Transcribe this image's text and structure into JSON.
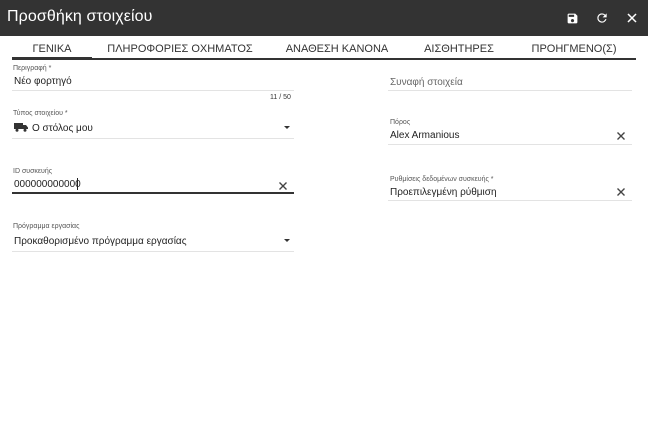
{
  "window": {
    "title": "Προσθήκη στοιχείου"
  },
  "tabs": [
    {
      "label": "ΓΕΝΙΚΑ",
      "active": true
    },
    {
      "label": "ΠΛΗΡΟΦΟΡΙΕΣ ΟΧΗΜΑΤΟΣ",
      "active": false
    },
    {
      "label": "ΑΝΑΘΕΣΗ ΚΑΝΟΝΑ",
      "active": false
    },
    {
      "label": "ΑΙΣΘΗΤΗΡΕΣ",
      "active": false
    },
    {
      "label": "ΠΡΟΗΓΜΕΝΟ(Σ)",
      "active": false
    }
  ],
  "form": {
    "description": {
      "label": "Περιγραφή *",
      "value": "Νέο φορτηγό",
      "counter": "11 / 50"
    },
    "asset_type": {
      "label": "Τύπος στοιχείου *",
      "value": "Ο στόλος μου",
      "icon": "truck-icon"
    },
    "device_id": {
      "label": "ID συσκευής",
      "value": "000000000000"
    },
    "work_schedule": {
      "label": "Πρόγραμμα εργασίας",
      "value": "Προκαθορισμένο πρόγραμμα εργασίας"
    },
    "related_items": {
      "placeholder": "Συναφή στοιχεία"
    },
    "resource": {
      "label": "Πόρος",
      "value": "Alex Armanious"
    },
    "device_data_settings": {
      "label": "Ρυθμίσεις δεδομένων συσκευής *",
      "value": "Προεπιλεγμένη ρύθμιση"
    }
  },
  "colors": {
    "titlebar": "#333333",
    "accent": "#333333",
    "field_line": "#e3e3e3"
  }
}
